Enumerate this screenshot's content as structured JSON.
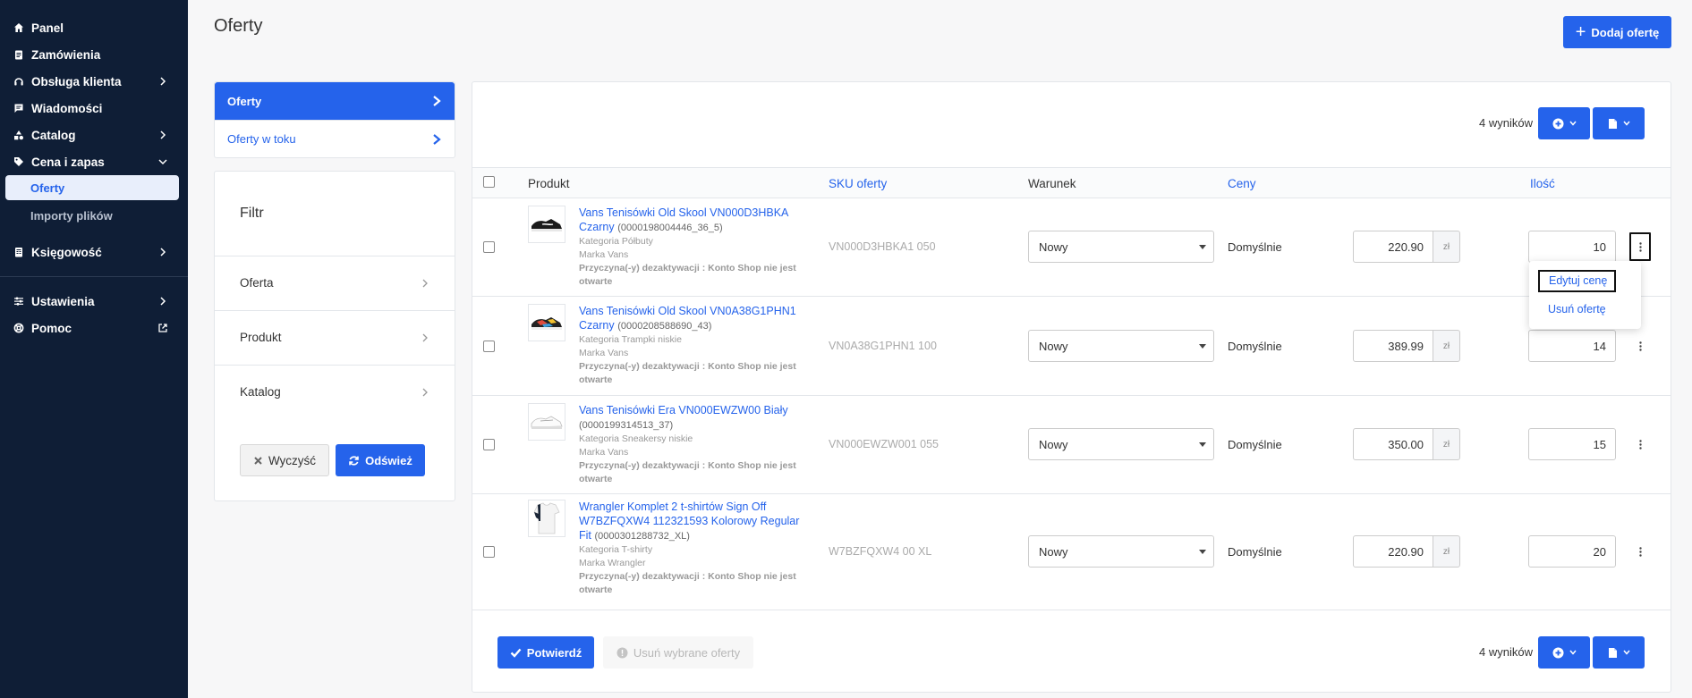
{
  "sidebar": {
    "items": [
      {
        "label": "Panel",
        "icon": "home-icon"
      },
      {
        "label": "Zamówienia",
        "icon": "clipboard-icon"
      },
      {
        "label": "Obsługa klienta",
        "icon": "headset-icon"
      },
      {
        "label": "Wiadomości",
        "icon": "message-icon"
      },
      {
        "label": "Catalog",
        "icon": "shapes-icon"
      },
      {
        "label": "Cena i zapas",
        "icon": "tag-icon"
      }
    ],
    "sub_items": [
      {
        "label": "Oferty",
        "active": true
      },
      {
        "label": "Importy plików",
        "active": false
      }
    ],
    "items2": [
      {
        "label": "Księgowość",
        "icon": "ledger-icon"
      }
    ],
    "items3": [
      {
        "label": "Ustawienia",
        "icon": "sliders-icon"
      },
      {
        "label": "Pomoc",
        "icon": "lifebuoy-icon"
      }
    ]
  },
  "header": {
    "title": "Oferty",
    "add_button": "Dodaj ofertę"
  },
  "subnav": [
    {
      "label": "Oferty",
      "active": true
    },
    {
      "label": "Oferty w toku",
      "active": false
    }
  ],
  "filter": {
    "title": "Filtr",
    "rows": [
      "Oferta",
      "Produkt",
      "Katalog"
    ],
    "clear": "Wyczyść",
    "refresh": "Odśwież"
  },
  "table": {
    "results": "4 wyników",
    "columns": {
      "product": "Produkt",
      "sku": "SKU oferty",
      "condition": "Warunek",
      "prices": "Ceny",
      "qty": "Ilość"
    },
    "rows": [
      {
        "name": "Vans Tenisówki Old Skool VN000D3HBKA Czarny",
        "code": "(0000198004446_36_5)",
        "category": "Kategoria Półbuty",
        "brand": "Marka Vans",
        "reason": "Przyczyna(-y) dezaktywacji : Konto Shop nie jest otwarte",
        "sku": "VN000D3HBKA1 050",
        "condition": "Nowy",
        "price_type": "Domyślnie",
        "price": "220.90",
        "currency": "zł",
        "qty": "10"
      },
      {
        "name": "Vans Tenisówki Old Skool VN0A38G1PHN1 Czarny",
        "code": "(0000208588690_43)",
        "category": "Kategoria Trampki niskie",
        "brand": "Marka Vans",
        "reason": "Przyczyna(-y) dezaktywacji : Konto Shop nie jest otwarte",
        "sku": "VN0A38G1PHN1 100",
        "condition": "Nowy",
        "price_type": "Domyślnie",
        "price": "389.99",
        "currency": "zł",
        "qty": "14"
      },
      {
        "name": "Vans Tenisówki Era VN000EWZW00 Biały",
        "code": "(0000199314513_37)",
        "category": "Kategoria Sneakersy niskie",
        "brand": "Marka Vans",
        "reason": "Przyczyna(-y) dezaktywacji : Konto Shop nie jest otwarte",
        "sku": "VN000EWZW001 055",
        "condition": "Nowy",
        "price_type": "Domyślnie",
        "price": "350.00",
        "currency": "zł",
        "qty": "15"
      },
      {
        "name": "Wrangler Komplet 2 t-shirtów Sign Off W7BZFQXW4 112321593 Kolorowy Regular Fit",
        "code": "(0000301288732_XL)",
        "category": "Kategoria T-shirty",
        "brand": "Marka Wrangler",
        "reason": "Przyczyna(-y) dezaktywacji : Konto Shop nie jest otwarte",
        "sku": "W7BZFQXW4 00 XL",
        "condition": "Nowy",
        "price_type": "Domyślnie",
        "price": "220.90",
        "currency": "zł",
        "qty": "20"
      }
    ],
    "row_menu": {
      "edit_price": "Edytuj cenę",
      "delete_offer": "Usuń ofertę"
    },
    "footer": {
      "confirm": "Potwierdź",
      "delete_selected": "Usuń wybrane oferty",
      "results": "4 wyników"
    }
  },
  "colors": {
    "accent": "#2563eb",
    "sidebar_bg": "#0f1e36"
  }
}
